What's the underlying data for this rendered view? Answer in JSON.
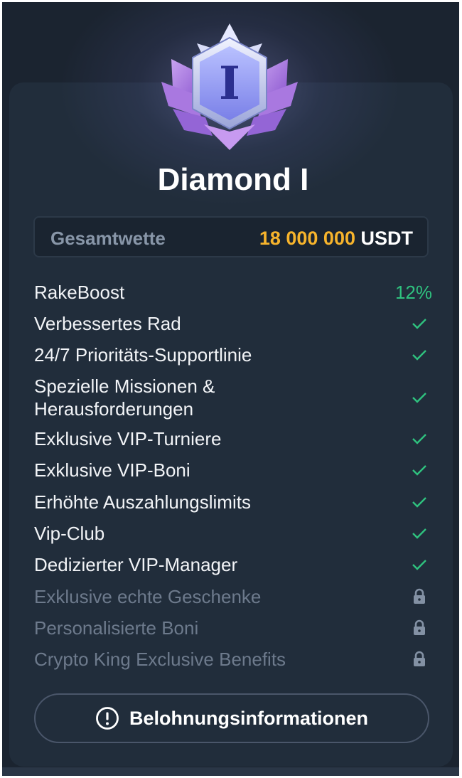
{
  "tier": {
    "name": "Diamond I",
    "badge_numeral": "I",
    "badge_icon": "diamond-tier-badge"
  },
  "wager": {
    "label": "Gesamtwette",
    "amount": "18 000 000",
    "currency": "USDT"
  },
  "benefits": [
    {
      "label": "RakeBoost",
      "value": "12%",
      "status": "value"
    },
    {
      "label": "Verbessertes Rad",
      "status": "included"
    },
    {
      "label": "24/7 Prioritäts-Supportlinie",
      "status": "included"
    },
    {
      "label": "Spezielle Missionen & Herausforderungen",
      "status": "included"
    },
    {
      "label": "Exklusive VIP-Turniere",
      "status": "included"
    },
    {
      "label": "Exklusive VIP-Boni",
      "status": "included"
    },
    {
      "label": "Erhöhte Auszahlungslimits",
      "status": "included"
    },
    {
      "label": "Vip-Club",
      "status": "included"
    },
    {
      "label": "Dedizierter VIP-Manager",
      "status": "included"
    },
    {
      "label": "Exklusive echte Geschenke",
      "status": "locked"
    },
    {
      "label": "Personalisierte Boni",
      "status": "locked"
    },
    {
      "label": "Crypto King Exclusive Benefits",
      "status": "locked"
    }
  ],
  "reward_button": {
    "label": "Belohnungsinformationen",
    "icon": "info-circle-icon"
  },
  "colors": {
    "accent_gold": "#f7b42c",
    "check_green": "#2fc27f",
    "card_bg": "#212d3b"
  }
}
